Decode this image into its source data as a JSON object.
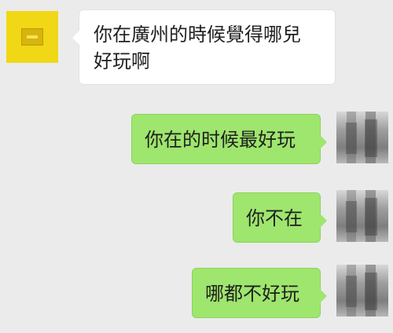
{
  "chat": {
    "messages": [
      {
        "text": "你在廣州的時候覺得哪兒好玩啊"
      },
      {
        "text": "你在的时候最好玩"
      },
      {
        "text": "你不在"
      },
      {
        "text": "哪都不好玩"
      }
    ]
  },
  "icons": {
    "left_avatar": "avatar",
    "right_avatar": "avatar"
  }
}
